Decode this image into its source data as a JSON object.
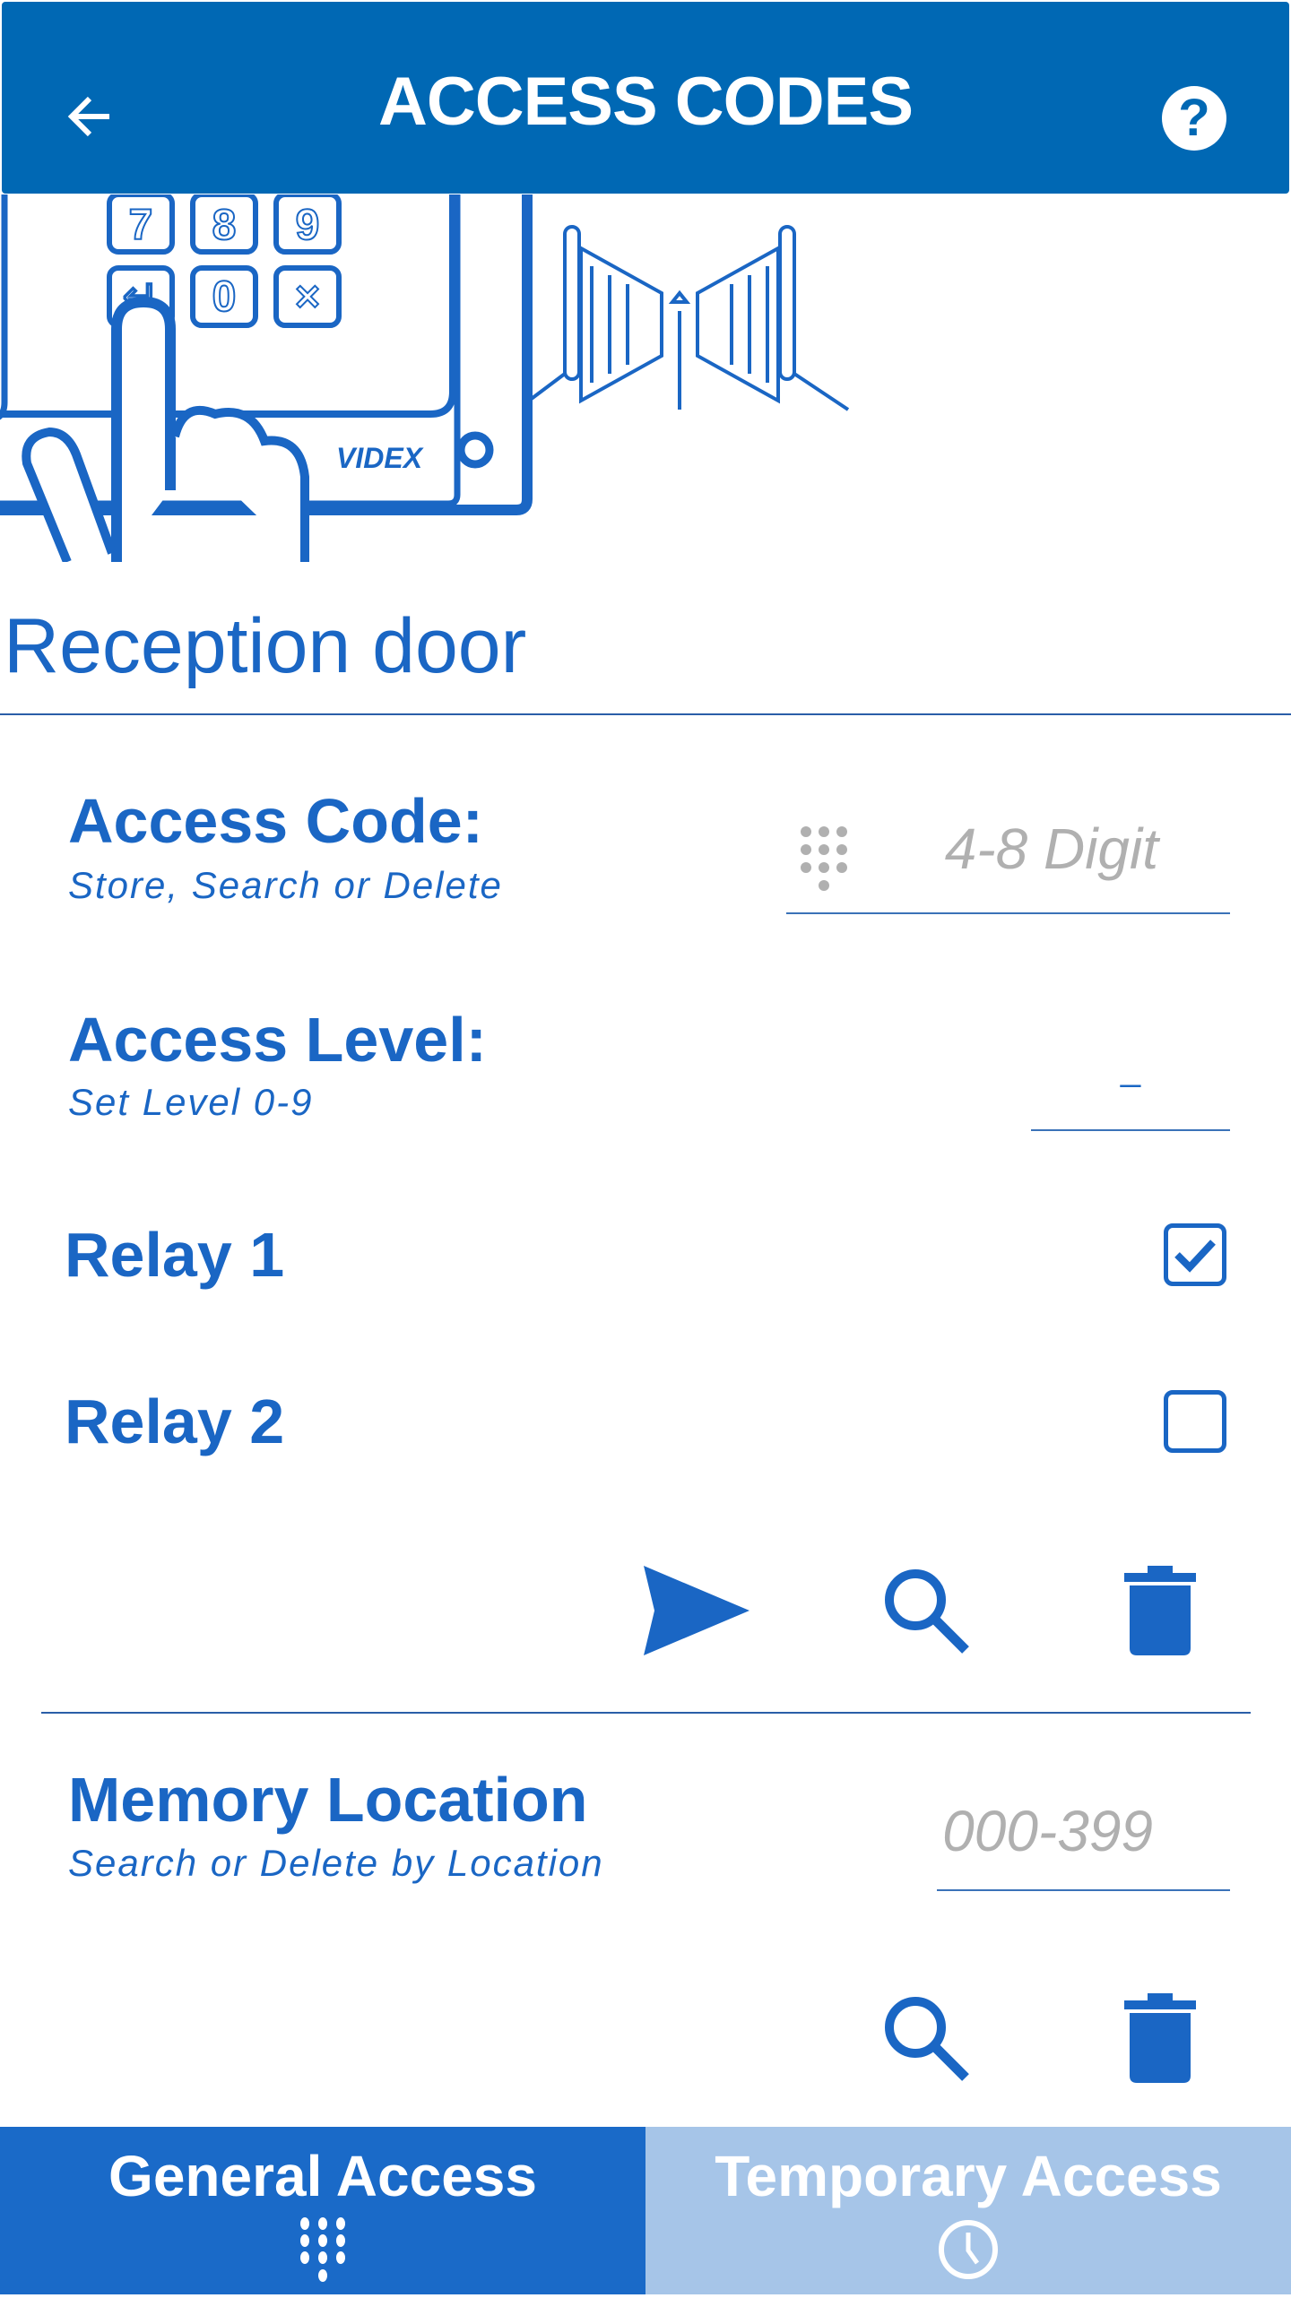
{
  "header": {
    "title": "ACCESS CODES",
    "back_icon": "arrow-left-icon",
    "help_icon": "help-circle-icon",
    "help_glyph": "?"
  },
  "illustration": {
    "brand": "VIDEX",
    "keys": [
      "7",
      "8",
      "9",
      "↵",
      "0",
      "×"
    ]
  },
  "door_name": "Reception door",
  "access_code": {
    "label": "Access Code:",
    "subtitle": "Store, Search or Delete",
    "placeholder": "4-8 Digit",
    "icon": "keypad-icon"
  },
  "access_level": {
    "label": "Access Level:",
    "subtitle": "Set Level 0-9",
    "value": "_"
  },
  "relays": [
    {
      "label": "Relay 1",
      "checked": true
    },
    {
      "label": "Relay 2",
      "checked": false
    }
  ],
  "actions": {
    "send_icon": "send-icon",
    "search_icon": "search-icon",
    "delete_icon": "trash-icon"
  },
  "memory_location": {
    "label": "Memory Location",
    "subtitle": "Search or Delete by Location",
    "placeholder": "000-399"
  },
  "tabs": [
    {
      "label": "General Access",
      "icon": "keypad-icon",
      "active": true,
      "color": "#1a6ac8"
    },
    {
      "label": "Temporary Access",
      "icon": "clock-icon",
      "active": false,
      "color": "#a6c5e8"
    }
  ],
  "colors": {
    "header": "#0068b4",
    "accent": "#1a66c4"
  }
}
